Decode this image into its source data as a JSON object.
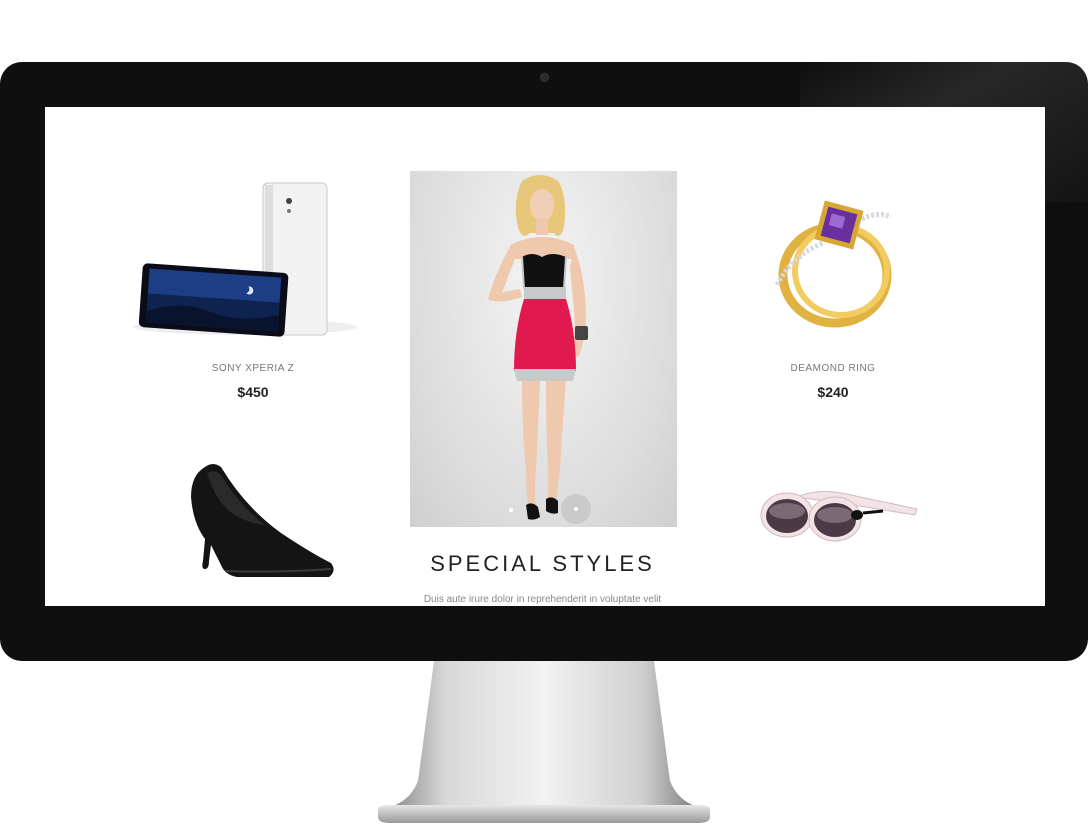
{
  "products": [
    {
      "name": "SONY XPERIA Z",
      "price": "$450"
    },
    {
      "name": "DEAMOND RING",
      "price": "$240"
    }
  ],
  "featured": {
    "title": "SPECIAL STYLES",
    "description": "Duis aute irure dolor in reprehenderit in voluptate velit"
  },
  "colors": {
    "dress_red": "#e0194f",
    "bezel": "#0f0f0f"
  }
}
